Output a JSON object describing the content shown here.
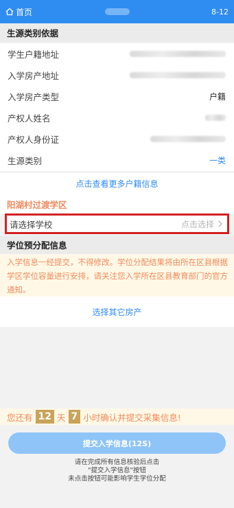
{
  "header": {
    "home_label": "首页",
    "date": "8-12"
  },
  "source_section": {
    "title": "生源类别依据",
    "rows": [
      {
        "label": "学生户籍地址",
        "value": ""
      },
      {
        "label": "入学房产地址",
        "value": ""
      },
      {
        "label": "入学房产类型",
        "value": "户籍"
      },
      {
        "label": "产权人姓名",
        "value": ""
      },
      {
        "label": "产权人身份证",
        "value": ""
      },
      {
        "label": "生源类别",
        "value": "一类"
      }
    ],
    "more_link": "点击查看更多户籍信息"
  },
  "district": {
    "name": "阳湖村过渡学区",
    "school_label": "请选择学校",
    "school_hint": "点击选择"
  },
  "prealloc_section": {
    "title": "学位预分配信息",
    "notice": "入学信息一经提交，不得修改。学位分配结果将由所在区县根据学区学位容量进行安排，请关注您入学所在区县教育部门的官方通知。",
    "other_property_link": "选择其它房产"
  },
  "countdown": {
    "prefix": "您还有",
    "days": "12",
    "days_unit": "天",
    "hours": "7",
    "suffix": "小时确认并提交采集信息!"
  },
  "submit": {
    "label": "提交入学信息(12S)"
  },
  "tips": {
    "line1": "请在完成所有信息核验后点击",
    "line2": "\"提交入学信息\"按钮",
    "line3": "未点击按钮可能影响学生学位分配"
  },
  "colors": {
    "header_bg": "#2f8cf0",
    "link": "#2f8cf0",
    "accent_orange": "#f08a5d",
    "highlight_border": "#d32020",
    "submit_bg": "#8ec4f7",
    "countdown_box": "#c8a45a"
  }
}
